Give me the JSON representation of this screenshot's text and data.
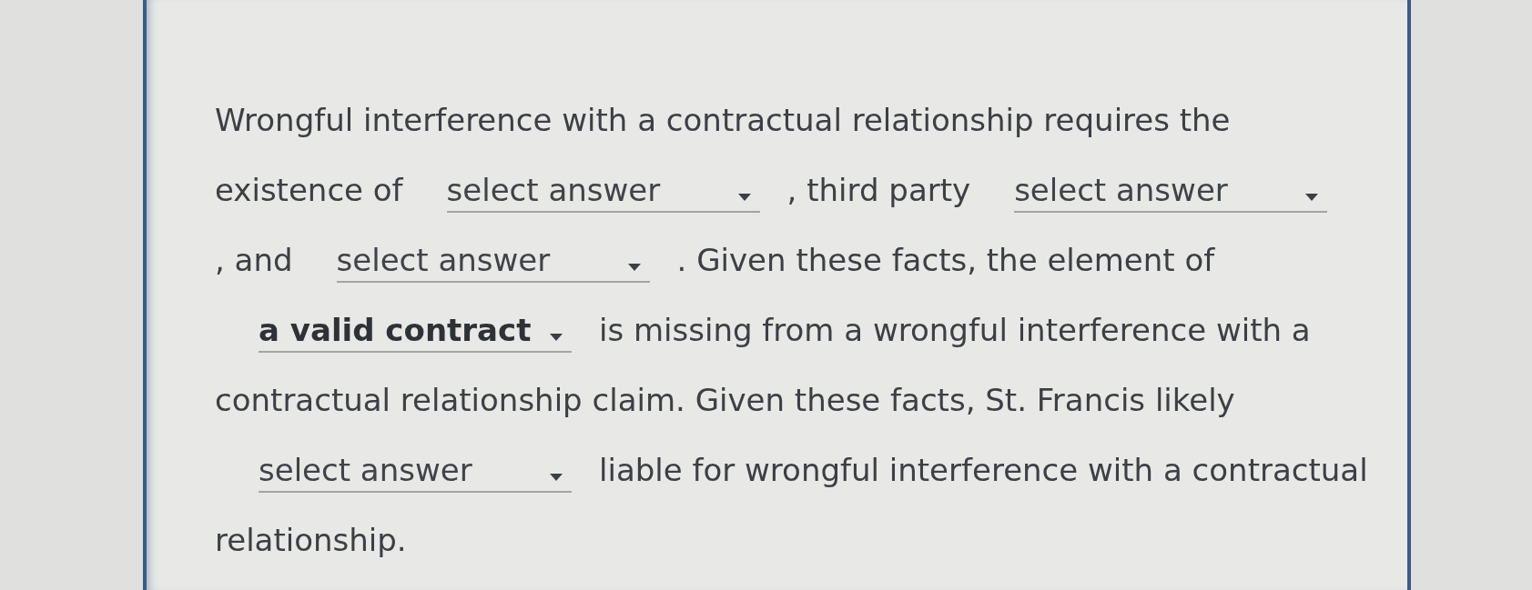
{
  "question": {
    "lines": [
      [
        {
          "kind": "text",
          "text": "Wrongful interference with a contractual relationship requires the"
        }
      ],
      [
        {
          "kind": "text",
          "text": "existence of"
        },
        {
          "kind": "dropdown",
          "placeholder": "select answer"
        },
        {
          "kind": "text",
          "text": ", third party"
        },
        {
          "kind": "dropdown",
          "placeholder": "select answer"
        }
      ],
      [
        {
          "kind": "text",
          "text": ", and"
        },
        {
          "kind": "dropdown",
          "placeholder": "select answer"
        },
        {
          "kind": "text",
          "text": ". Given these facts, the element of"
        }
      ],
      [
        {
          "kind": "dropdown",
          "value": "a valid contract"
        },
        {
          "kind": "text",
          "text": "is missing from a wrongful interference with a"
        }
      ],
      [
        {
          "kind": "text",
          "text": "contractual relationship claim. Given these facts, St. Francis likely"
        }
      ],
      [
        {
          "kind": "dropdown",
          "placeholder": "select answer"
        },
        {
          "kind": "text",
          "text": "liable for wrongful interference with a contractual"
        }
      ],
      [
        {
          "kind": "text",
          "text": "relationship."
        }
      ]
    ]
  }
}
